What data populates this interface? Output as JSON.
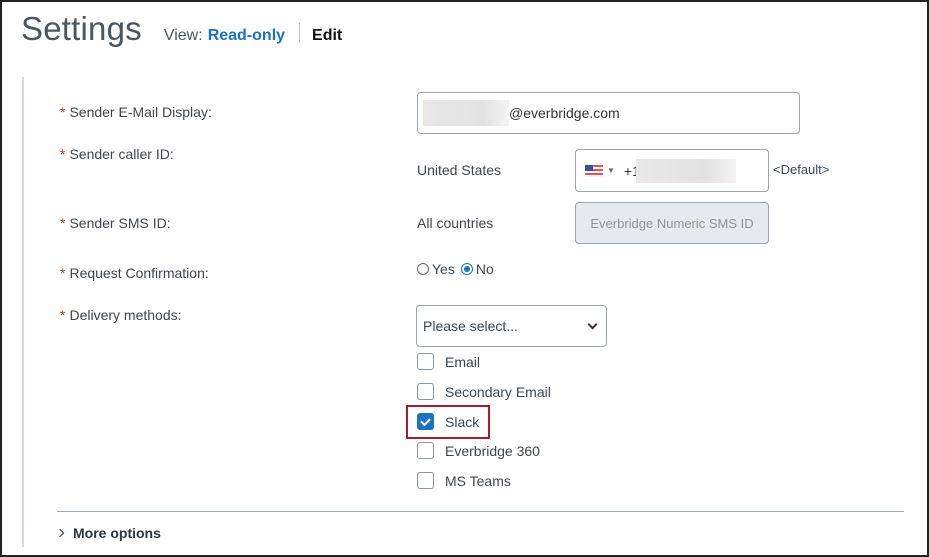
{
  "header": {
    "title": "Settings",
    "view_label": "View:",
    "readonly_link": "Read-only",
    "edit_link": "Edit"
  },
  "form": {
    "sender_email": {
      "label": "Sender E-Mail Display:",
      "required": "*",
      "value_suffix": "@everbridge.com"
    },
    "sender_caller_id": {
      "label": "Sender caller ID:",
      "required": "*",
      "country": "United States",
      "phone_prefix": "+1",
      "default_tag": "<Default>"
    },
    "sender_sms_id": {
      "label": "Sender SMS ID:",
      "required": "*",
      "country": "All countries",
      "placeholder": "Everbridge Numeric SMS ID"
    },
    "request_confirmation": {
      "label": "Request Confirmation:",
      "required": "*",
      "options": [
        {
          "label": "Yes",
          "selected": false
        },
        {
          "label": "No",
          "selected": true
        }
      ]
    },
    "delivery_methods": {
      "label": "Delivery methods:",
      "required": "*",
      "select_placeholder": "Please select...",
      "options": [
        {
          "label": "Email",
          "checked": false
        },
        {
          "label": "Secondary Email",
          "checked": false
        },
        {
          "label": "Slack",
          "checked": true
        },
        {
          "label": "Everbridge 360",
          "checked": false
        },
        {
          "label": "MS Teams",
          "checked": false
        }
      ]
    }
  },
  "more_options": "More options",
  "colors": {
    "accent": "#1a73c2",
    "required": "#c0392b",
    "highlight": "#a51c2c"
  }
}
